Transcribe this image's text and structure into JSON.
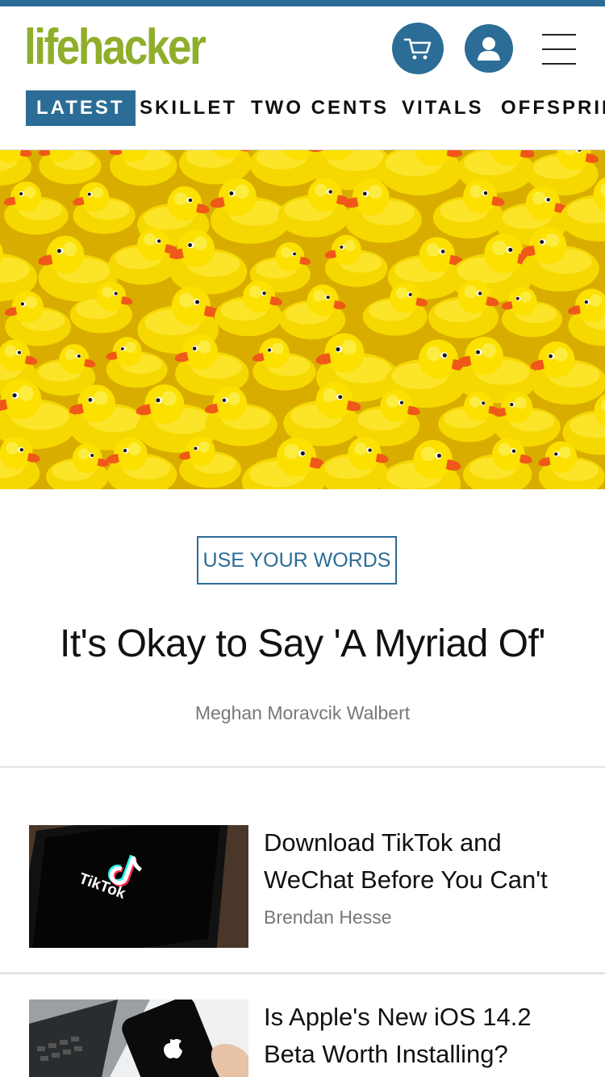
{
  "colors": {
    "brand_blue": "#2b6d96",
    "logo_green": "#8fae2b",
    "byline_gray": "#777777"
  },
  "header": {
    "logo_text": "lifehacker",
    "cart_icon": "cart-icon",
    "account_icon": "user-icon",
    "menu_icon": "hamburger-menu-icon"
  },
  "nav": {
    "items": [
      "LATEST",
      "SKILLET",
      "TWO CENTS",
      "VITALS",
      "OFFSPRIN"
    ],
    "active": "LATEST"
  },
  "featured": {
    "rubric": "USE YOUR WORDS",
    "title": "It's Okay to Say 'A Myriad Of'",
    "author": "Meghan Moravcik Walbert"
  },
  "articles": [
    {
      "title": "Download TikTok and WeChat Before You Can't",
      "author": "Brendan Hesse",
      "thumb_text": "TikTok"
    },
    {
      "title": "Is Apple's New iOS 14.2 Beta Worth Installing?",
      "author": ""
    }
  ]
}
